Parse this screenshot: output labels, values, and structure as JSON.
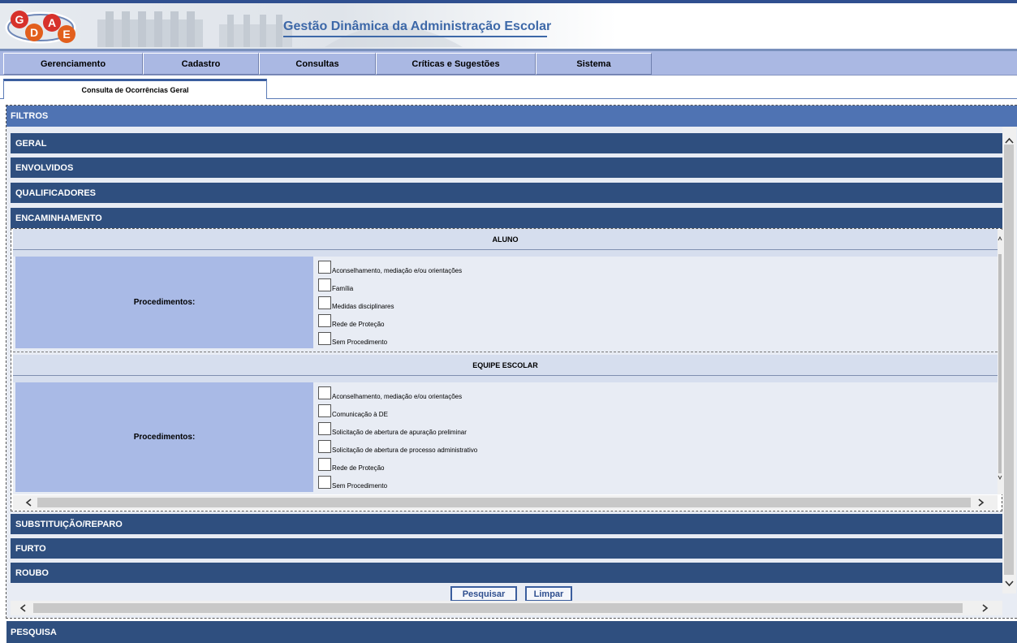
{
  "app": {
    "logo_letters": [
      "G",
      "D",
      "A",
      "E"
    ],
    "title": "Gestão Dinâmica da Administração Escolar"
  },
  "menu": {
    "items": [
      {
        "label": "Gerenciamento"
      },
      {
        "label": "Cadastro"
      },
      {
        "label": "Consultas"
      },
      {
        "label": "Críticas e Sugestões"
      },
      {
        "label": "Sistema"
      }
    ]
  },
  "tabs": [
    {
      "label": "Consulta de Ocorrências Geral",
      "active": true
    }
  ],
  "filtros": {
    "title": "FILTROS",
    "sections_top": [
      {
        "label": "GERAL"
      },
      {
        "label": "ENVOLVIDOS"
      },
      {
        "label": "QUALIFICADORES"
      },
      {
        "label": "ENCAMINHAMENTO"
      }
    ],
    "encaminhamento": {
      "aluno": {
        "title": "ALUNO",
        "label": "Procedimentos:",
        "options": [
          "Aconselhamento, mediação e/ou orientações",
          "Família",
          "Medidas disciplinares",
          "Rede de Proteção",
          "Sem Procedimento"
        ]
      },
      "equipe": {
        "title": "EQUIPE ESCOLAR",
        "label": "Procedimentos:",
        "options": [
          "Aconselhamento, mediação e/ou orientações",
          "Comunicação à DE",
          "Solicitação de abertura de apuração preliminar",
          "Solicitação de abertura de processo administrativo",
          "Rede de Proteção",
          "Sem Procedimento"
        ]
      }
    },
    "sections_bottom": [
      {
        "label": "SUBSTITUIÇÃO/REPARO"
      },
      {
        "label": "FURTO"
      },
      {
        "label": "ROUBO"
      }
    ],
    "buttons": {
      "search": "Pesquisar",
      "clear": "Limpar"
    }
  },
  "pesquisa": {
    "title": "PESQUISA"
  },
  "icons": {
    "scroll_up": "chevron-up-icon",
    "scroll_down": "chevron-down-icon",
    "scroll_left": "chevron-left-icon",
    "scroll_right": "chevron-right-icon"
  },
  "colors": {
    "header_title": "#3d68a8",
    "menu_bg": "#aab8e3",
    "filtros_bar": "#4f73b3",
    "section_bar": "#2f4f7f",
    "procedure_label_bg": "#a9bae6",
    "panel_bg": "#e8ecf4"
  }
}
